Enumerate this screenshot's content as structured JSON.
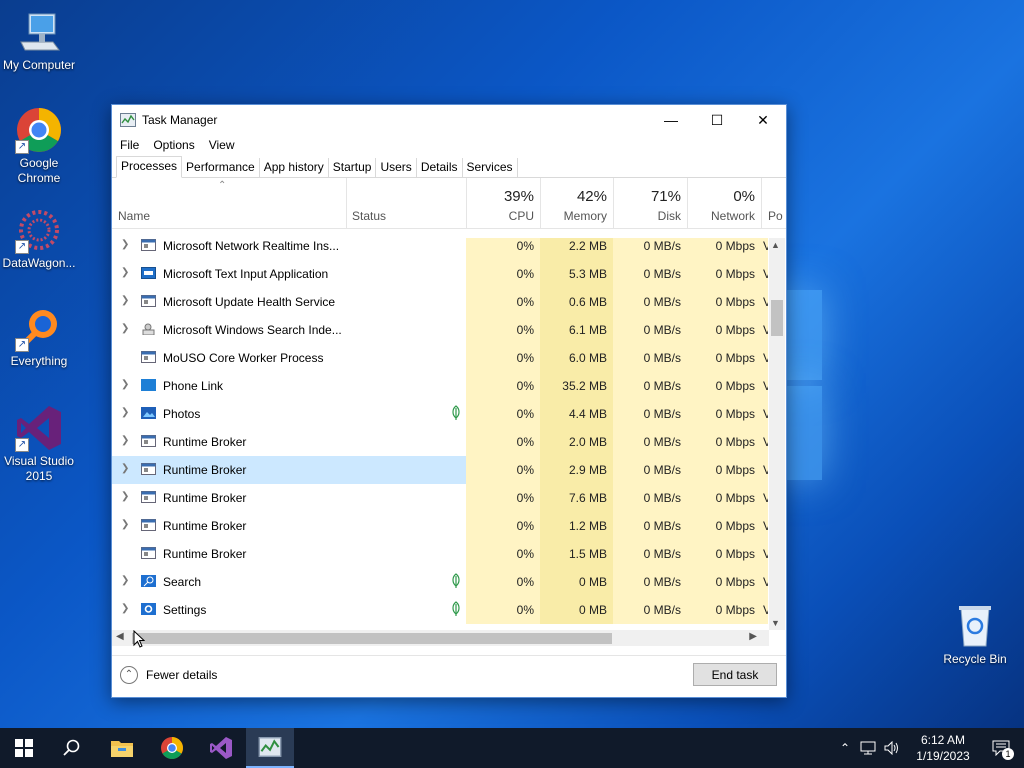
{
  "desktop": {
    "icons": [
      {
        "label": "My Computer"
      },
      {
        "label": "Google Chrome"
      },
      {
        "label": "DataWagon..."
      },
      {
        "label": "Everything"
      },
      {
        "label": "Visual Studio 2015"
      },
      {
        "label": "Recycle Bin"
      }
    ]
  },
  "window": {
    "title": "Task Manager",
    "minimize": "—",
    "maximize": "☐",
    "close": "✕"
  },
  "menu": [
    "File",
    "Options",
    "View"
  ],
  "tabs": [
    "Processes",
    "Performance",
    "App history",
    "Startup",
    "Users",
    "Details",
    "Services"
  ],
  "columns": {
    "name": "Name",
    "status": "Status",
    "cpu": {
      "pct": "39%",
      "label": "CPU"
    },
    "memory": {
      "pct": "42%",
      "label": "Memory"
    },
    "disk": {
      "pct": "71%",
      "label": "Disk"
    },
    "network": {
      "pct": "0%",
      "label": "Network"
    },
    "power": "Po"
  },
  "processes": [
    {
      "name": "Microsoft Network Realtime Ins...",
      "cpu": "0%",
      "mem": "2.2 MB",
      "disk": "0 MB/s",
      "net": "0 Mbps",
      "pow": "V"
    },
    {
      "name": "Microsoft Text Input Application",
      "cpu": "0%",
      "mem": "5.3 MB",
      "disk": "0 MB/s",
      "net": "0 Mbps",
      "pow": "V"
    },
    {
      "name": "Microsoft Update Health Service",
      "cpu": "0%",
      "mem": "0.6 MB",
      "disk": "0 MB/s",
      "net": "0 Mbps",
      "pow": "V"
    },
    {
      "name": "Microsoft Windows Search Inde...",
      "cpu": "0%",
      "mem": "6.1 MB",
      "disk": "0 MB/s",
      "net": "0 Mbps",
      "pow": "V"
    },
    {
      "name": "MoUSO Core Worker Process",
      "cpu": "0%",
      "mem": "6.0 MB",
      "disk": "0 MB/s",
      "net": "0 Mbps",
      "pow": "V"
    },
    {
      "name": "Phone Link",
      "cpu": "0%",
      "mem": "35.2 MB",
      "disk": "0 MB/s",
      "net": "0 Mbps",
      "pow": "V"
    },
    {
      "name": "Photos",
      "cpu": "0%",
      "mem": "4.4 MB",
      "disk": "0 MB/s",
      "net": "0 Mbps",
      "pow": "V"
    },
    {
      "name": "Runtime Broker",
      "cpu": "0%",
      "mem": "2.0 MB",
      "disk": "0 MB/s",
      "net": "0 Mbps",
      "pow": "V"
    },
    {
      "name": "Runtime Broker",
      "cpu": "0%",
      "mem": "2.9 MB",
      "disk": "0 MB/s",
      "net": "0 Mbps",
      "pow": "V"
    },
    {
      "name": "Runtime Broker",
      "cpu": "0%",
      "mem": "7.6 MB",
      "disk": "0 MB/s",
      "net": "0 Mbps",
      "pow": "V"
    },
    {
      "name": "Runtime Broker",
      "cpu": "0%",
      "mem": "1.2 MB",
      "disk": "0 MB/s",
      "net": "0 Mbps",
      "pow": "V"
    },
    {
      "name": "Runtime Broker",
      "cpu": "0%",
      "mem": "1.5 MB",
      "disk": "0 MB/s",
      "net": "0 Mbps",
      "pow": "V"
    },
    {
      "name": "Search",
      "cpu": "0%",
      "mem": "0 MB",
      "disk": "0 MB/s",
      "net": "0 Mbps",
      "pow": "V"
    },
    {
      "name": "Settings",
      "cpu": "0%",
      "mem": "0 MB",
      "disk": "0 MB/s",
      "net": "0 Mbps",
      "pow": "V"
    }
  ],
  "footer": {
    "fewer_details": "Fewer details",
    "end_task": "End task"
  },
  "taskbar": {
    "time": "6:12 AM",
    "date": "1/19/2023",
    "notification_count": "1"
  }
}
